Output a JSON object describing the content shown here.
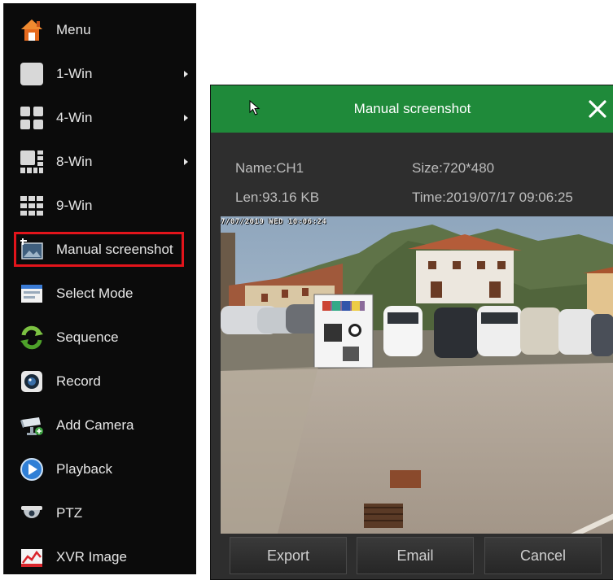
{
  "menu": {
    "items": [
      {
        "label": "Menu",
        "icon": "house-icon",
        "has_submenu": false
      },
      {
        "label": "1-Win",
        "icon": "single-window-icon",
        "has_submenu": true
      },
      {
        "label": "4-Win",
        "icon": "quad-window-icon",
        "has_submenu": true
      },
      {
        "label": "8-Win",
        "icon": "eight-window-icon",
        "has_submenu": true
      },
      {
        "label": "9-Win",
        "icon": "nine-window-icon",
        "has_submenu": false
      },
      {
        "label": "Manual screenshot",
        "icon": "screenshot-icon",
        "has_submenu": false,
        "highlighted": true
      },
      {
        "label": "Select Mode",
        "icon": "select-mode-icon",
        "has_submenu": false
      },
      {
        "label": "Sequence",
        "icon": "sequence-icon",
        "has_submenu": false
      },
      {
        "label": "Record",
        "icon": "record-icon",
        "has_submenu": false
      },
      {
        "label": "Add Camera",
        "icon": "cctv-camera-icon",
        "has_submenu": false
      },
      {
        "label": "Playback",
        "icon": "playback-icon",
        "has_submenu": false
      },
      {
        "label": "PTZ",
        "icon": "dome-camera-icon",
        "has_submenu": false
      },
      {
        "label": "XVR Image",
        "icon": "image-chart-icon",
        "has_submenu": false
      }
    ],
    "highlight_color": "#e3141b"
  },
  "dialog": {
    "title": "Manual screenshot",
    "header_color": "#1f8a3a",
    "name": "Name:CH1",
    "size": "Size:720*480",
    "length": "Len:93.16 KB",
    "time": "Time:2019/07/17 09:06:25",
    "osd_timestamp": "7/07/2019 WED 10:06:24",
    "buttons": {
      "export": "Export",
      "email": "Email",
      "cancel": "Cancel"
    }
  }
}
